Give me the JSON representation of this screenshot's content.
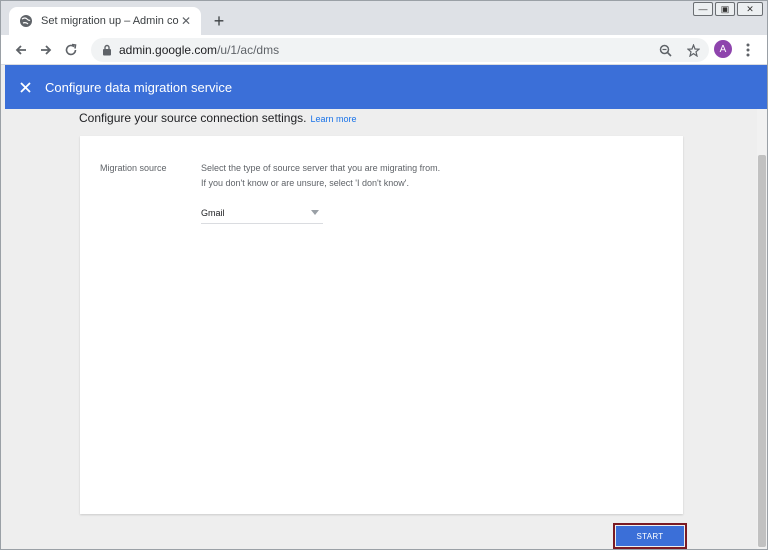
{
  "browser": {
    "tab_title": "Set migration up – Admin consol",
    "url_host": "admin.google.com",
    "url_path": "/u/1/ac/dms",
    "avatar_letter": "A",
    "window_controls": {
      "minimize": "—",
      "restore": "▣",
      "close": "✕"
    }
  },
  "icons": {
    "favicon": "globe-icon",
    "tab_close": "close-icon",
    "new_tab": "plus-icon",
    "back": "arrow-left-icon",
    "forward": "arrow-right-icon",
    "reload": "reload-icon",
    "lock": "lock-icon",
    "zoom": "magnifier-icon",
    "bookmark": "star-icon",
    "menu": "three-dots-vertical-icon",
    "close_dialog": "close-icon"
  },
  "appbar": {
    "title": "Configure data migration service",
    "color": "#3b6fd8"
  },
  "content": {
    "heading": "Configure your source connection settings.",
    "learn_more": "Learn more",
    "migration_source": {
      "label": "Migration source",
      "description_line1": "Select the type of source server that you are migrating from.",
      "description_line2": "If you don't know or are unsure, select 'I don't know'.",
      "selected_value": "Gmail"
    }
  },
  "actions": {
    "start_label": "START",
    "highlight_color": "#7a1a23"
  }
}
